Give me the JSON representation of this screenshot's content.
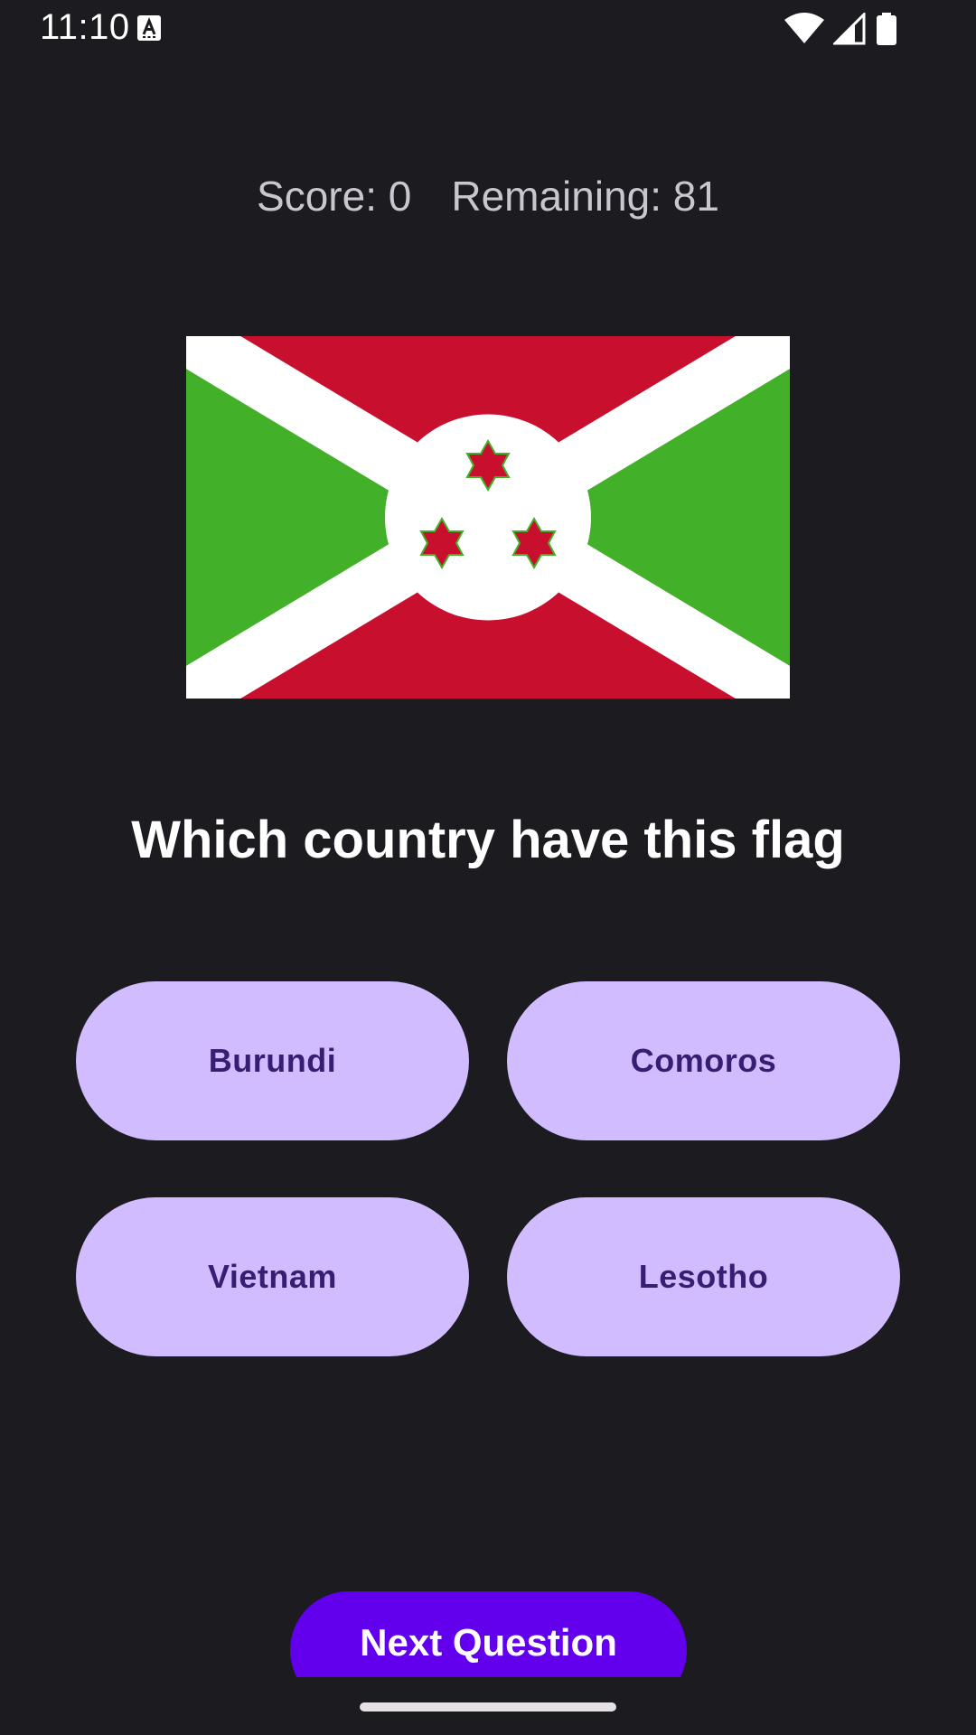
{
  "status_bar": {
    "time": "11:10",
    "icons": [
      "accessibility-a-icon",
      "wifi-icon",
      "signal-icon",
      "battery-icon"
    ]
  },
  "score": {
    "score_text": "Score: 0",
    "remaining_text": "Remaining: 81"
  },
  "flag": {
    "icon": "burundi-flag",
    "colors": {
      "red": "#c8102e",
      "green": "#43b02a",
      "white": "#ffffff"
    }
  },
  "question": "Which country have this flag",
  "answers": [
    "Burundi",
    "Comoros",
    "Vietnam",
    "Lesotho"
  ],
  "next_button": "Next Question",
  "colors": {
    "background": "#1c1b20",
    "answer_bg": "#d0bcff",
    "answer_text": "#381e72",
    "primary": "#6200ee"
  }
}
